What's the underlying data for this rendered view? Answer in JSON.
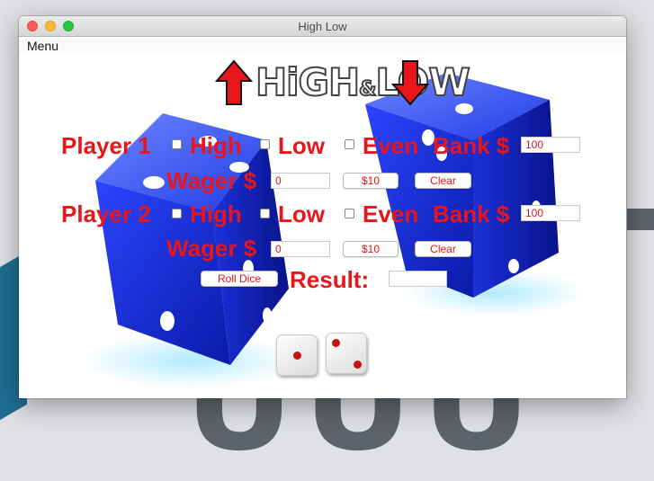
{
  "window": {
    "title": "High Low"
  },
  "menu": {
    "items": [
      "Menu"
    ]
  },
  "logo": {
    "text_left": "HiGH",
    "amp": "&",
    "text_right": "LOW"
  },
  "player1": {
    "label": "Player 1",
    "high_label": "High",
    "low_label": "Low",
    "even_label": "Even",
    "bank_label": "Bank $",
    "bank_value": "100",
    "wager_label": "Wager $",
    "wager_value": "0",
    "add_button": "$10",
    "clear_button": "Clear"
  },
  "player2": {
    "label": "Player 2",
    "high_label": "High",
    "low_label": "Low",
    "even_label": "Even",
    "bank_label": "Bank $",
    "bank_value": "100",
    "wager_label": "Wager $",
    "wager_value": "0",
    "add_button": "$10",
    "clear_button": "Clear"
  },
  "controls": {
    "roll_button": "Roll Dice",
    "result_label": "Result:",
    "result_value": ""
  },
  "dice": {
    "die1": 1,
    "die2": 2
  },
  "colors": {
    "accent_red": "#e8161b",
    "dice_blue": "#1a2fe0",
    "pip_red": "#c41313"
  }
}
